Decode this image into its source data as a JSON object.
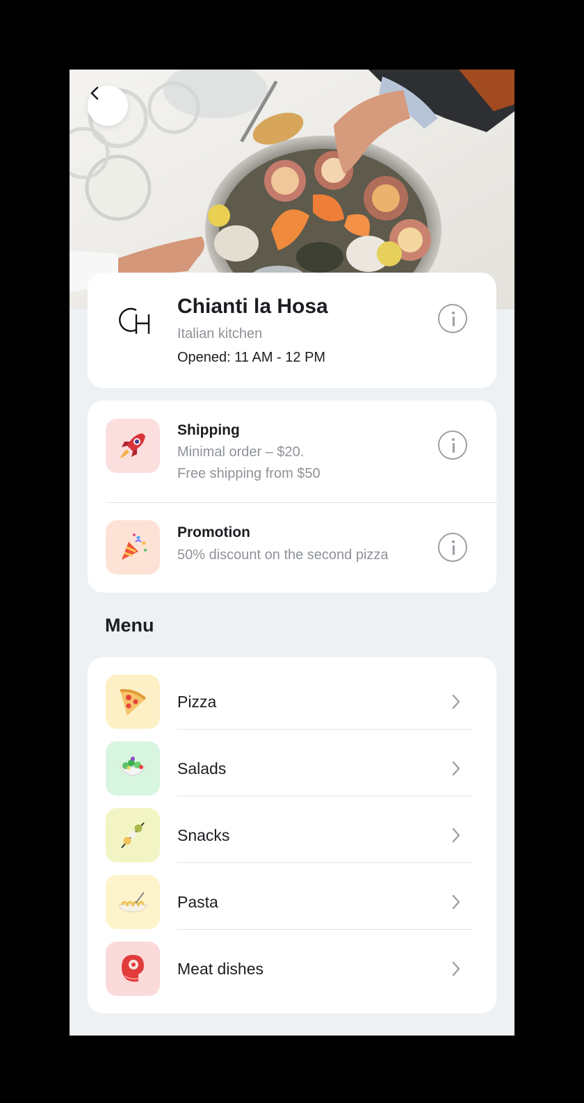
{
  "restaurant": {
    "name": "Chianti la Hosa",
    "logo_text": "CH",
    "cuisine": "Italian kitchen",
    "hours": "Opened: 11 AM - 12 PM"
  },
  "features": [
    {
      "title": "Shipping",
      "line1": "Minimal order – $20.",
      "line2": "Free shipping from $50",
      "icon": "rocket-icon"
    },
    {
      "title": "Promotion",
      "line1": "50% discount on the second pizza",
      "icon": "party-popper-icon"
    }
  ],
  "menu": {
    "heading": "Menu",
    "items": [
      {
        "label": "Pizza",
        "icon": "pizza-icon"
      },
      {
        "label": "Salads",
        "icon": "salad-icon"
      },
      {
        "label": "Snacks",
        "icon": "skewer-icon"
      },
      {
        "label": "Pasta",
        "icon": "pasta-icon"
      },
      {
        "label": "Meat dishes",
        "icon": "steak-icon"
      }
    ]
  },
  "colors": {
    "background": "#eef1f4",
    "card": "#ffffff",
    "text_primary": "#1b1d21",
    "text_secondary": "#8e9297"
  }
}
